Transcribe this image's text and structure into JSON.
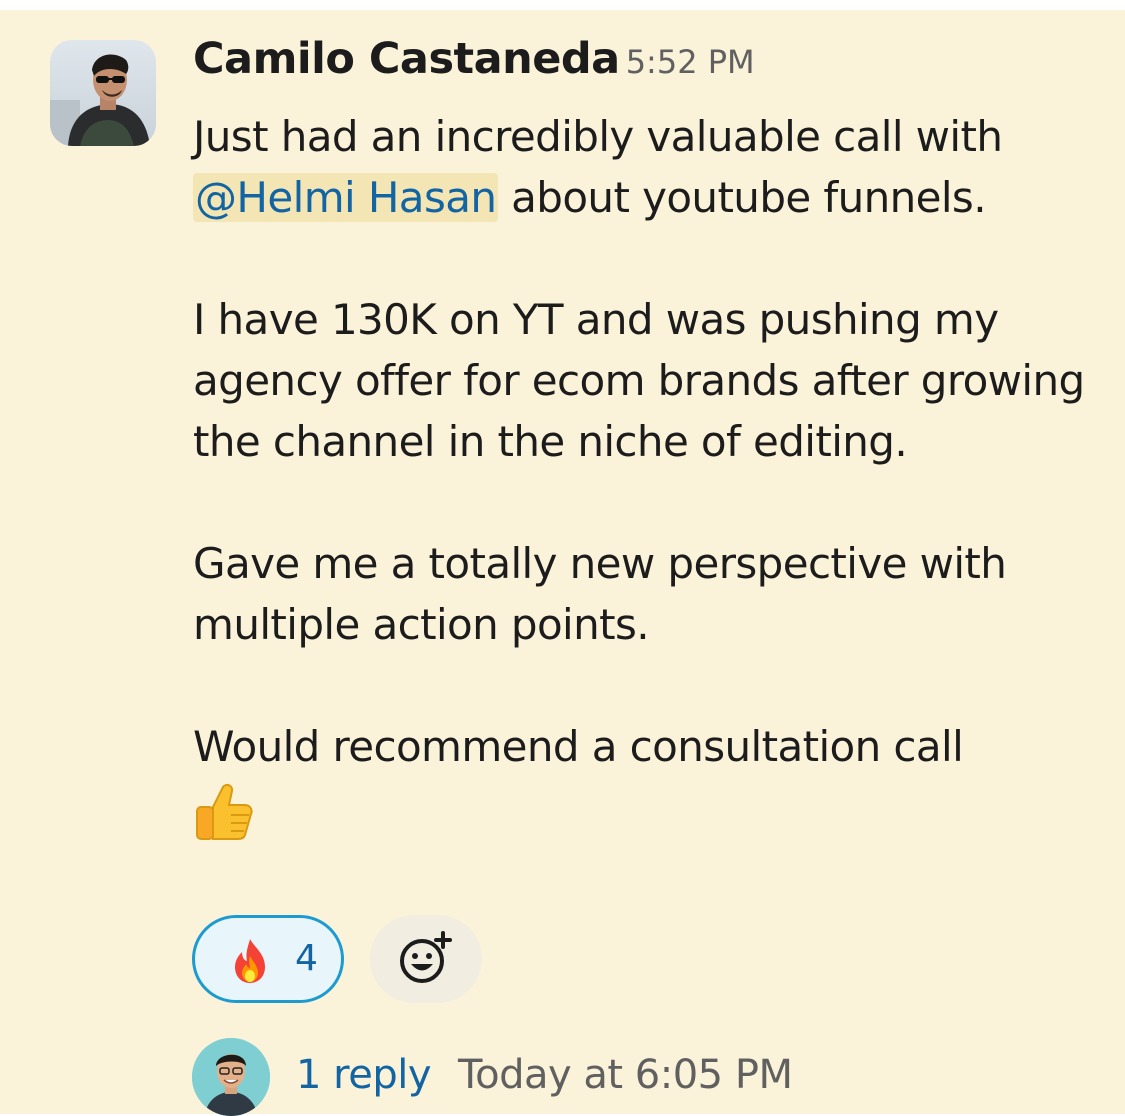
{
  "message": {
    "sender": "Camilo Castaneda",
    "timestamp": "5:52 PM",
    "line1": "Just had an incredibly valuable call with",
    "mention": "@Helmi Hasan",
    "line2_rest": " about youtube funnels.",
    "paragraph2": "I have 130K on YT and was pushing my agency offer for ecom brands after growing the channel in the niche of editing.",
    "paragraph3": "Gave me a totally new perspective with multiple action points.",
    "paragraph4": "Would recommend a consultation call",
    "paragraph4_emoji": "thumbs-up-icon"
  },
  "reactions": [
    {
      "emoji": "fire-icon",
      "count": "4",
      "selected": true
    }
  ],
  "add_reaction_icon": "add-reaction-icon",
  "thread": {
    "reply_count_label": "1 reply",
    "last_reply_time": "Today at 6:05 PM"
  },
  "colors": {
    "highlight_background": "#fbf3d9",
    "link": "#1264a3",
    "reaction_border": "#1d9bd1"
  }
}
